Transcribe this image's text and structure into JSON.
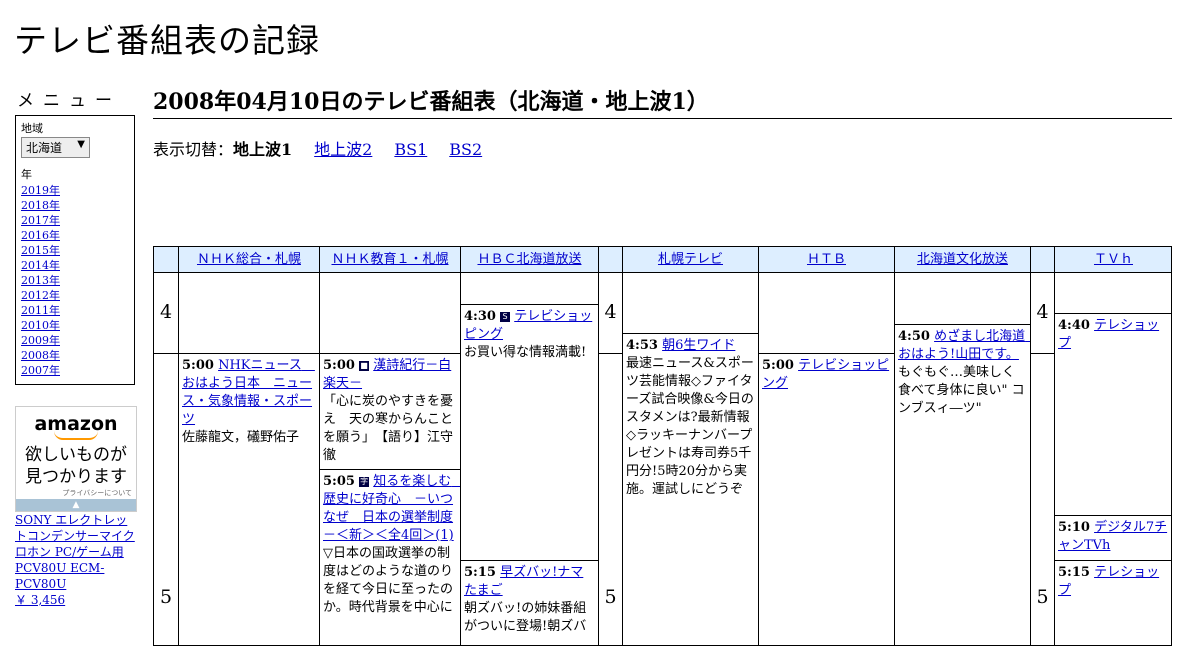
{
  "site_title": "テレビ番組表の記録",
  "menu": {
    "heading": "メニュー",
    "region_label": "地域",
    "region_value": "北海道",
    "year_label": "年",
    "years": [
      "2019年",
      "2018年",
      "2017年",
      "2016年",
      "2015年",
      "2014年",
      "2013年",
      "2012年",
      "2011年",
      "2010年",
      "2009年",
      "2008年",
      "2007年"
    ]
  },
  "ad": {
    "logo": "amazon",
    "line1": "欲しいものが",
    "line2": "見つかります",
    "privacy": "プライバシーについて",
    "arrow": "▲"
  },
  "product": {
    "name": "SONY エレクトレットコンデンサーマイクロホン PC/ゲーム用 PCV80U ECM-PCV80U",
    "price": "￥ 3,456"
  },
  "page_title": "2008年04月10日のテレビ番組表（北海道・地上波1）",
  "switch": {
    "label": "表示切替：",
    "current": "地上波1",
    "links": [
      "地上波2",
      "BS1",
      "BS2"
    ]
  },
  "channels": [
    "ＮＨＫ総合・札幌",
    "ＮＨＫ教育１・札幌",
    "ＨＢＣ北海道放送",
    "札幌テレビ",
    "ＨＴＢ",
    "北海道文化放送",
    "ＴＶｈ"
  ],
  "hours": [
    "4",
    "5"
  ],
  "programs": {
    "hbc_430": {
      "time": "4:30",
      "icon": "S",
      "title": "テレビショッピング",
      "desc": "お買い得な情報満載!"
    },
    "hbc_515": {
      "time": "5:15",
      "title": "早ズバッ!ナマたまご",
      "desc": "朝ズバッ!の姉妹番組がついに登場!朝ズバ"
    },
    "nhk_500": {
      "time": "5:00",
      "title": "NHKニュース　おはよう日本　ニュース・気象情報・スポーツ",
      "desc": "佐藤龍文，礒野佑子"
    },
    "etv_500": {
      "time": "5:00",
      "icon": "■",
      "title": "漢詩紀行－白楽天－",
      "desc": "「心に炭のやすきを憂え　天の寒からんことを願う」　【語り】江守徹"
    },
    "etv_505": {
      "time": "5:05",
      "icon": "字",
      "title": "知るを楽しむ　歴史に好奇心　－いつなぜ　日本の選挙制度－＜新＞＜全4回＞(1)",
      "desc": "▽日本の国政選挙の制度はどのような道のりを経て今日に至ったのか。時代背景を中心に"
    },
    "stv_453": {
      "time": "4:53",
      "title": "朝6生ワイド",
      "desc": "最速ニュース&スポーツ芸能情報◇ファイターズ試合映像&今日のスタメンは?最新情報◇ラッキーナンバープレゼントは寿司券5千円分!5時20分から実施。運試しにどうぞ"
    },
    "htb_500": {
      "time": "5:00",
      "title": "テレビショッピング",
      "desc": ""
    },
    "uhb_450": {
      "time": "4:50",
      "title": "めざまし北海道　おはよう!山田です。",
      "desc": "もぐもぐ…美味しく食べて身体に良い\" コンブスィ―ツ\""
    },
    "tvh_440": {
      "time": "4:40",
      "title": "テレショップ",
      "desc": ""
    },
    "tvh_510": {
      "time": "5:10",
      "title": "デジタル7チャンTVh",
      "desc": ""
    },
    "tvh_515": {
      "time": "5:15",
      "title": "テレショップ",
      "desc": ""
    }
  }
}
